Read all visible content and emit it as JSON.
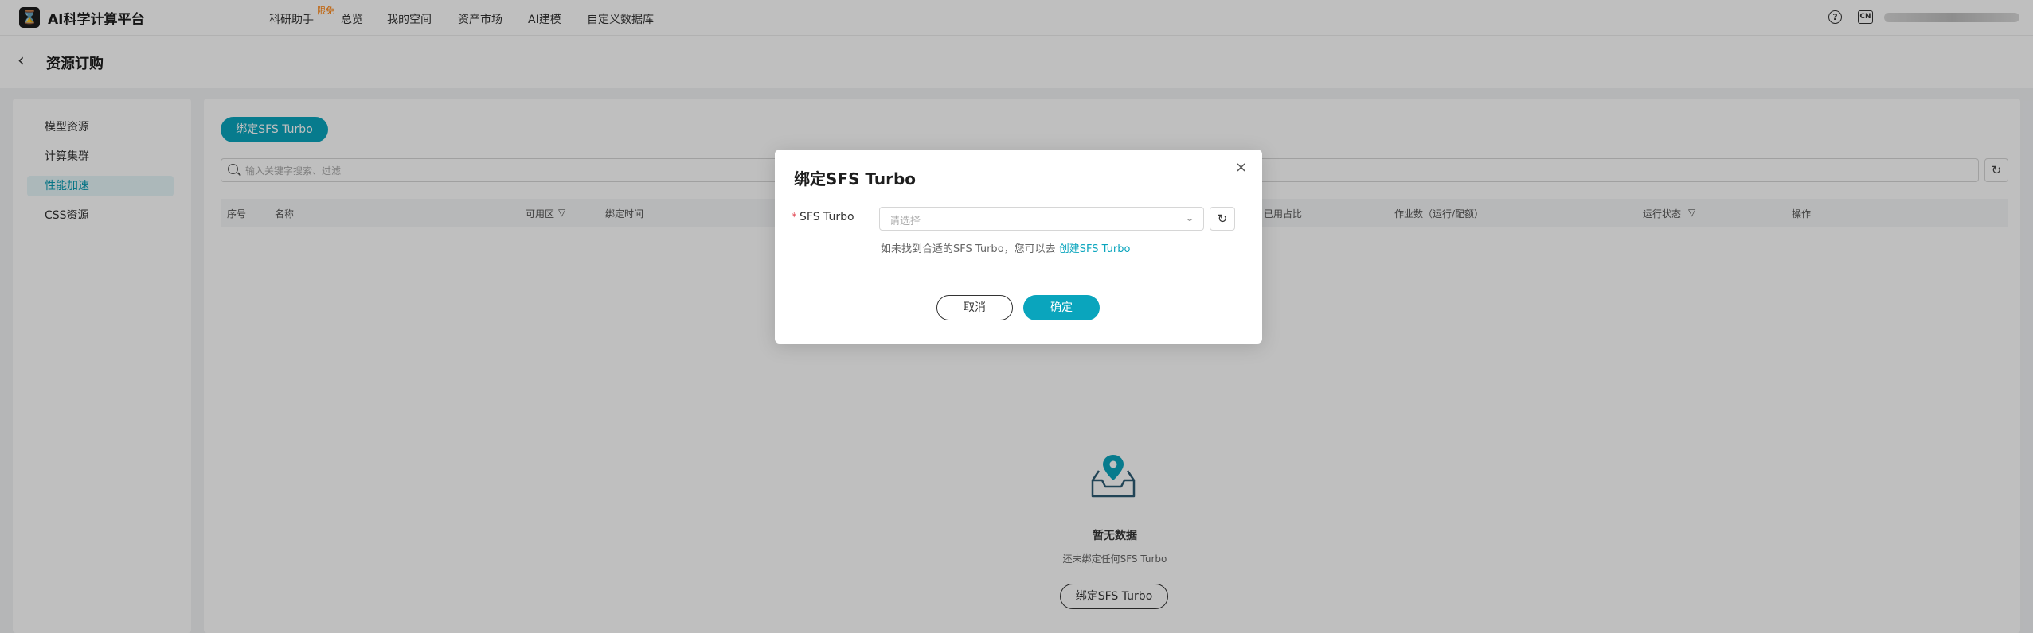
{
  "app": {
    "name": "AI科学计算平台",
    "logo_glyph": "⌛"
  },
  "nav": {
    "items": [
      "科研助手",
      "总览",
      "我的空间",
      "资产市场",
      "AI建模",
      "自定义数据库"
    ],
    "new_badge": "限免"
  },
  "header_right": {
    "help_glyph": "?",
    "lang": "CN"
  },
  "page": {
    "back_glyph": "‹",
    "title": "资源订购"
  },
  "sidebar": {
    "items": [
      "模型资源",
      "计算集群",
      "性能加速",
      "CSS资源"
    ],
    "active_index": 2
  },
  "main": {
    "bind_button": "绑定SFS Turbo",
    "search_placeholder": "输入关键字搜索、过滤",
    "refresh_glyph": "↻",
    "columns": [
      "序号",
      "名称",
      "可用区",
      "绑定时间",
      "已用占比",
      "作业数（运行/配额）",
      "运行状态",
      "操作"
    ],
    "empty": {
      "title": "暂无数据",
      "subtitle": "还未绑定任何SFS Turbo",
      "button": "绑定SFS Turbo"
    }
  },
  "modal": {
    "title": "绑定SFS Turbo",
    "close_glyph": "×",
    "field_label": "SFS Turbo",
    "required_mark": "*",
    "select_placeholder": "请选择",
    "refresh_glyph": "↻",
    "hint_text": "如未找到合适的SFS Turbo，您可以去 ",
    "hint_link": "创建SFS Turbo",
    "cancel": "取消",
    "confirm": "确定"
  },
  "colors": {
    "accent": "#0aa5bd",
    "required": "#e34d59",
    "badge": "#ff7d00"
  }
}
